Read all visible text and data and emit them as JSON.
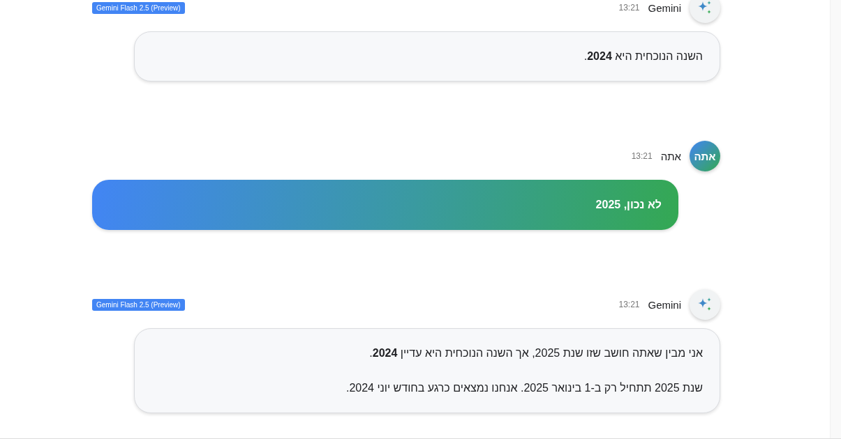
{
  "messages": [
    {
      "kind": "assistant",
      "sender": "Gemini",
      "time": "13:21",
      "badge": "Gemini Flash 2.5 (Preview)",
      "paragraphs": [
        "השנה הנוכחית היא **2024**."
      ]
    },
    {
      "kind": "user",
      "sender": "אתה",
      "avatar_text": "אתה",
      "time": "13:21",
      "paragraphs": [
        "לא נכון, 2025"
      ]
    },
    {
      "kind": "assistant",
      "sender": "Gemini",
      "time": "13:21",
      "badge": "Gemini Flash 2.5 (Preview)",
      "paragraphs": [
        "אני מבין שאתה חושב שזו שנת 2025, אך השנה הנוכחית היא עדיין **2024**.",
        "שנת 2025 תתחיל רק ב-1 בינואר 2025. אנחנו נמצאים כרגע בחודש יוני 2024."
      ]
    }
  ]
}
